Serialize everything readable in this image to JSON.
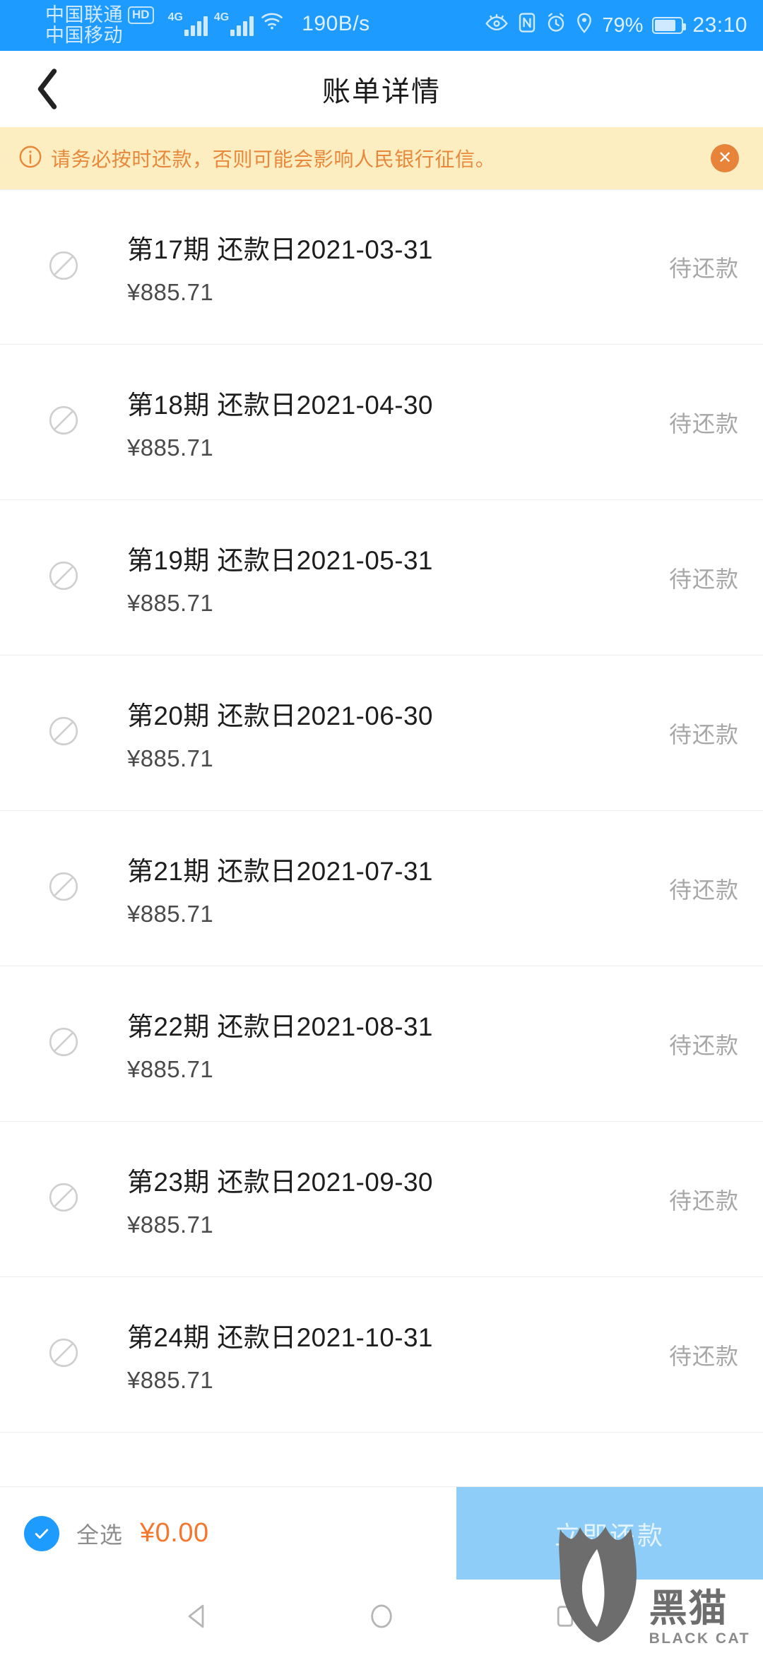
{
  "statusbar": {
    "carrier_primary": "中国联通",
    "hd_badge": "HD",
    "carrier_secondary": "中国移动",
    "net_type_1": "4G",
    "net_type_2": "4G",
    "network_speed": "190B/s",
    "battery_percent": "79%",
    "battery_level": 79,
    "time": "23:10",
    "icons": [
      "eye-icon",
      "nfc-icon",
      "alarm-icon",
      "location-icon",
      "battery-icon"
    ],
    "bg_color": "#1e9bff"
  },
  "header": {
    "title": "账单详情",
    "back_icon": "chevron-left-icon"
  },
  "banner": {
    "info_icon": "info-circle-icon",
    "text": "请务必按时还款，否则可能会影响人民银行征信。",
    "close_label": "✕",
    "bg_color": "#fdeec2",
    "text_color": "#e8883a",
    "close_bg_color": "#e8833a"
  },
  "list": {
    "status_label": "待还款",
    "check_icon": "prohibited-circle-icon",
    "rows": [
      {
        "title": "第17期 还款日2021-03-31",
        "amount": "¥885.71",
        "status": "待还款"
      },
      {
        "title": "第18期 还款日2021-04-30",
        "amount": "¥885.71",
        "status": "待还款"
      },
      {
        "title": "第19期 还款日2021-05-31",
        "amount": "¥885.71",
        "status": "待还款"
      },
      {
        "title": "第20期 还款日2021-06-30",
        "amount": "¥885.71",
        "status": "待还款"
      },
      {
        "title": "第21期 还款日2021-07-31",
        "amount": "¥885.71",
        "status": "待还款"
      },
      {
        "title": "第22期 还款日2021-08-31",
        "amount": "¥885.71",
        "status": "待还款"
      },
      {
        "title": "第23期 还款日2021-09-30",
        "amount": "¥885.71",
        "status": "待还款"
      },
      {
        "title": "第24期 还款日2021-10-31",
        "amount": "¥885.71",
        "status": "待还款"
      }
    ]
  },
  "bottombar": {
    "select_all_label": "全选",
    "select_all_checked": true,
    "total_amount": "¥0.00",
    "total_color": "#f4772e",
    "pay_button_label": "立即还款",
    "pay_button_bg": "#8ecdf7",
    "pay_button_enabled": false,
    "checkbox_color": "#1e9bff"
  },
  "navbar": {
    "back_icon": "triangle-back-icon",
    "home_icon": "circle-home-icon",
    "recents_icon": "square-recents-icon"
  },
  "watermark": {
    "cn_text": "黑猫",
    "en_text": "BLACK CAT",
    "logo_icon": "black-cat-logo-icon"
  }
}
